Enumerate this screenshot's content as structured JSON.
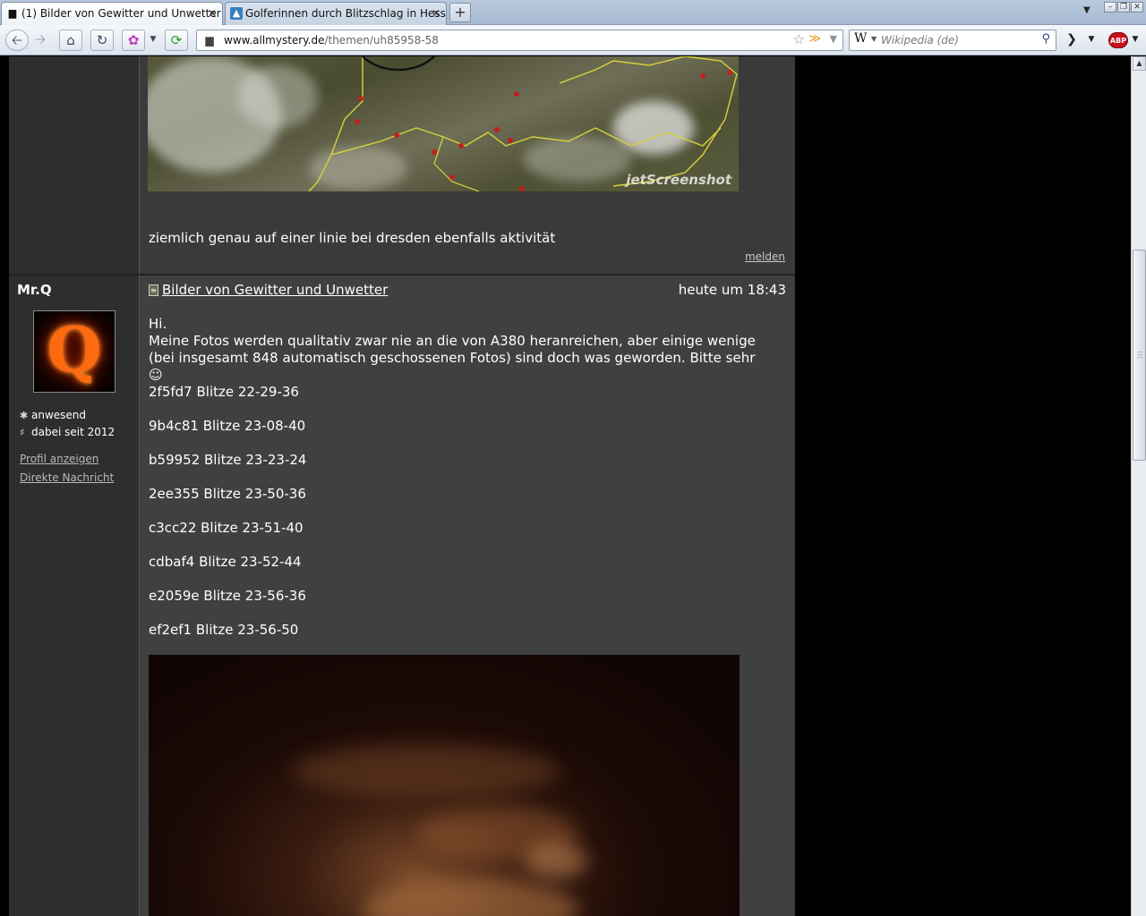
{
  "browser": {
    "tabs": [
      {
        "title": "(1) Bilder von Gewitter und Unwetter ...",
        "active": true
      },
      {
        "title": "Golferinnen durch Blitzschlag in Hess...",
        "active": false
      }
    ],
    "new_tab_symbol": "+",
    "url_domain": "www.allmystery.de",
    "url_path": "/themen/uh85958-58",
    "search_engine_letter": "W",
    "search_placeholder": "Wikipedia (de)",
    "abp_label": "ABP"
  },
  "previous_post": {
    "image_watermark": "jetScreenshot",
    "text": "ziemlich genau auf einer linie bei dresden ebenfalls aktivität",
    "report_link": "melden"
  },
  "post": {
    "author": {
      "name": "Mr.Q",
      "avatar_letter": "Q",
      "status": "anwesend",
      "member_since": "dabei seit 2012",
      "profile_link": "Profil anzeigen",
      "message_link": "Direkte Nachricht"
    },
    "title": "Bilder von Gewitter und Unwetter",
    "timestamp": "heute um 18:43",
    "greeting": "Hi.",
    "intro": "Meine Fotos werden qualitativ zwar nie an die von A380 heranreichen, aber einige wenige (bei insgesamt 848 automatisch geschossenen Fotos) sind doch was geworden. Bitte sehr ☺",
    "image_lines": [
      "2f5fd7 Blitze 22-29-36",
      "9b4c81 Blitze 23-08-40",
      "b59952 Blitze 23-23-24",
      "2ee355 Blitze 23-50-36",
      "c3cc22 Blitze 23-51-40",
      "cdbaf4 Blitze 23-52-44",
      "e2059e Blitze 23-56-36",
      "ef2ef1 Blitze 23-56-50"
    ]
  },
  "colors": {
    "page_bg": "#000000",
    "post_bg": "#404040",
    "user_col_bg": "#2e2e2e",
    "text": "#ffffff",
    "link_muted": "#b8b8b8"
  }
}
